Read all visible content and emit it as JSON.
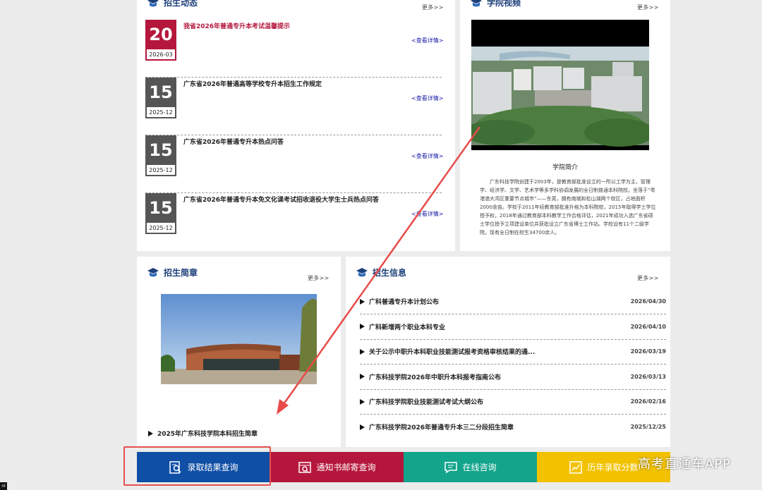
{
  "news": {
    "title": "招生动态",
    "more": "更多>>",
    "detail": "<查看详情>",
    "items": [
      {
        "day": "20",
        "ym": "2026-03",
        "title": "我省2026年普通专升本考试温馨提示",
        "color": "#b5173c"
      },
      {
        "day": "15",
        "ym": "2025-12",
        "title": "广东省2026年普通高等学校专升本招生工作规定",
        "color": "#555555"
      },
      {
        "day": "15",
        "ym": "2025-12",
        "title": "广东省2026年普通专升本热点问答",
        "color": "#555555"
      },
      {
        "day": "15",
        "ym": "2025-12",
        "title": "广东省2026年普通专升本免文化课考试招收退役大学生士兵热点问答",
        "color": "#555555"
      }
    ]
  },
  "video": {
    "title": "学院视频",
    "more": "更多>>",
    "intro_heading": "学院简介",
    "intro_text": "广东科技学院创建于2003年，是教育部批准设立的一所以工学为主，管理学、经济学、文学、艺术学等多学科协调发展的全日制普通本科院校。坐落于“粤港澳大湾区重要节点城市”——东莞，拥有南城和松山湖两个校区，占地面积2000余亩。学校于2011年经教育部批准升格为本科院校，2015年取得学士学位授予权，2018年通过教育部本科教学工作合格评估，2021年成功入选广东省硕士学位授予立项建设单位并获批设立广东省博士工作站。学校设有11个二级学院，现有全日制在校生34700余人。"
  },
  "brochure": {
    "title": "招生简章",
    "more": "更多>>",
    "item": "2025年广东科技学院本科招生简章"
  },
  "info": {
    "title": "招生信息",
    "more": "更多>>",
    "items": [
      {
        "text": "广科普通专升本计划公布",
        "date": "2026/04/30"
      },
      {
        "text": "广科新增两个职业本科专业",
        "date": "2026/04/10"
      },
      {
        "text": "关于公示中职升本科职业技能测试报考资格审核结果的通...",
        "date": "2026/03/19"
      },
      {
        "text": "广东科技学院2026年中职升本科报考指南公布",
        "date": "2026/03/13"
      },
      {
        "text": "广东科技学院职业技能测试考试大纲公布",
        "date": "2026/02/16"
      },
      {
        "text": "广东科技学院2026年普通专升本三二分段招生简章",
        "date": "2025/12/25"
      }
    ]
  },
  "buttons": [
    {
      "label": "录取结果查询",
      "color": "#0f4fa6",
      "icon": "search-doc-icon"
    },
    {
      "label": "通知书邮寄查询",
      "color": "#b5173c",
      "icon": "mail-search-icon"
    },
    {
      "label": "在线咨询",
      "color": "#12a58c",
      "icon": "chat-icon"
    },
    {
      "label": "历年录取分数",
      "color": "#f2c200",
      "icon": "score-icon"
    }
  ],
  "watermark": "高考直通车APP",
  "corner_badge": "nl"
}
